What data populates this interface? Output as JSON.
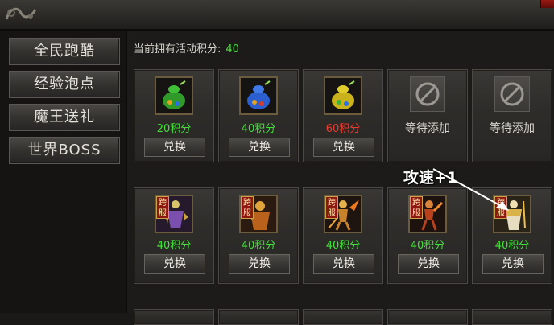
{
  "sidebar": {
    "items": [
      {
        "label": "全民跑酷"
      },
      {
        "label": "经验泡点"
      },
      {
        "label": "魔王送礼"
      },
      {
        "label": "世界BOSS"
      }
    ]
  },
  "points": {
    "label": "当前拥有活动积分:",
    "value": "40"
  },
  "row1": [
    {
      "price": "20积分",
      "price_color": "green",
      "button": "兑换",
      "icon": "green-loot-bag-icon"
    },
    {
      "price": "40积分",
      "price_color": "green",
      "button": "兑换",
      "icon": "blue-loot-bag-icon"
    },
    {
      "price": "60积分",
      "price_color": "red",
      "button": "兑换",
      "icon": "yellow-loot-bag-icon"
    },
    {
      "status": "等待添加",
      "icon": "prohibited-icon"
    },
    {
      "status": "等待添加",
      "icon": "prohibited-icon"
    }
  ],
  "annotation": "攻速+1",
  "row2": [
    {
      "tag": [
        "跨",
        "服"
      ],
      "price": "40积分",
      "button": "兑换",
      "icon": "purple-armor-figure-icon"
    },
    {
      "tag": [
        "跨",
        "服"
      ],
      "price": "40积分",
      "button": "兑换",
      "icon": "gold-warrior-figure-icon"
    },
    {
      "tag": [
        "跨",
        "服"
      ],
      "price": "40积分",
      "button": "兑换",
      "icon": "flame-warrior-figure-icon"
    },
    {
      "tag": [
        "跨",
        "服"
      ],
      "price": "40积分",
      "button": "兑换",
      "icon": "fire-dancer-figure-icon"
    },
    {
      "tag": [
        "跨",
        "服"
      ],
      "price": "40积分",
      "button": "兑换",
      "icon": "white-knight-figure-icon"
    }
  ],
  "colors": {
    "green": "#43e03a",
    "red": "#ef3a2b",
    "accent_gold": "#c9a24a"
  }
}
